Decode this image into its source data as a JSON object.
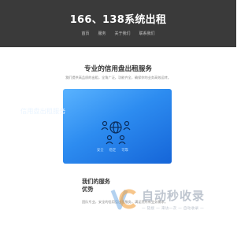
{
  "header": {
    "title": "166、138系统出租",
    "nav": [
      "首页",
      "服务",
      "关于我们",
      "联系我们"
    ]
  },
  "main": {
    "section_title": "专业的信用盘出租服务",
    "section_desc": "我们提供高品质的出租，全角广泛，功能齐全，确保你的业务高效运转。",
    "card": {
      "title": "信用盘出租服务",
      "tags": [
        "安全",
        "稳定",
        "可靠"
      ],
      "icon": "people-globe-icon"
    },
    "about": {
      "title_line1": "我们的服务",
      "title_line2": "优势",
      "desc": "团队专业，安全的信用盘出租服务，满足您所有业务需求。"
    }
  },
  "watermark": {
    "name": "自动秒收录",
    "slogan": "一 链接 一 来访一次 一 自动收录 一"
  },
  "colors": {
    "header_bg": "#3a3a3a",
    "card_gradient_start": "#5ab3ff",
    "card_gradient_end": "#1565d8"
  }
}
